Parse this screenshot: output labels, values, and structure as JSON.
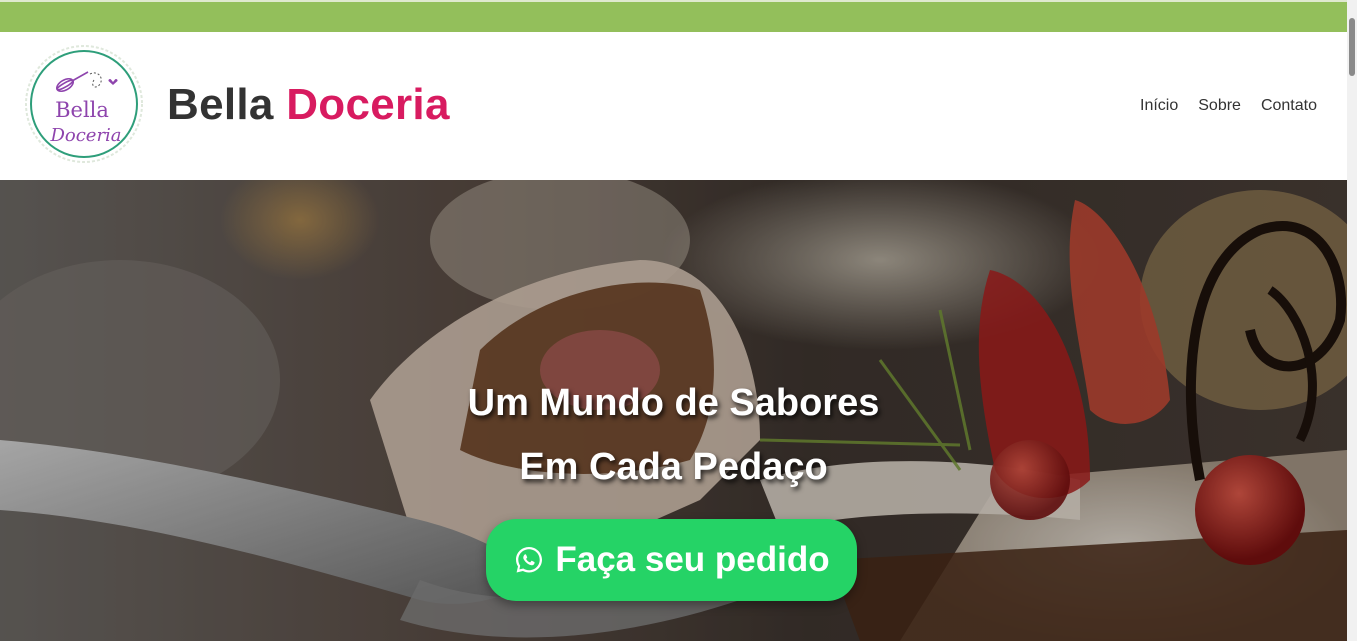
{
  "brand": {
    "name_part1": "Bella",
    "name_part2": "Doceria",
    "logo_text_line1": "Bella",
    "logo_text_line2": "Doceria",
    "logo_icon": "whisk-icon"
  },
  "nav": {
    "items": [
      {
        "label": "Início"
      },
      {
        "label": "Sobre"
      },
      {
        "label": "Contato"
      }
    ]
  },
  "hero": {
    "title_line1": "Um Mundo de Sabores",
    "title_line2": "Em Cada Pedaço",
    "cta_label": "Faça seu pedido",
    "cta_icon": "whatsapp-icon"
  },
  "colors": {
    "top_bar": "#93bf5b",
    "brand_text": "#333333",
    "brand_accent": "#d81b60",
    "cta": "#25d366",
    "logo_ring": "#2e9e7a",
    "logo_text": "#8e44ad"
  }
}
